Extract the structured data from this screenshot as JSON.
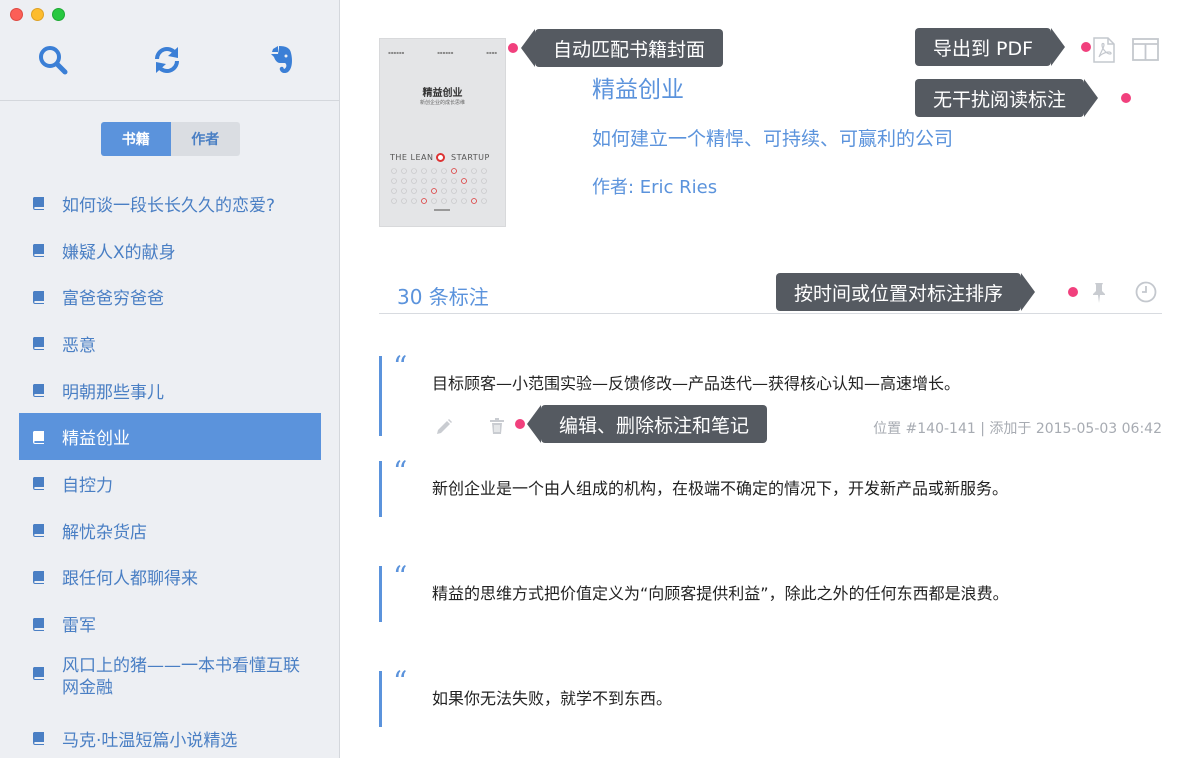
{
  "sidebar": {
    "tabs": [
      {
        "label": "书籍",
        "active": true
      },
      {
        "label": "作者",
        "active": false
      }
    ],
    "books": [
      {
        "title": "如何谈一段长长久久的恋爱?",
        "active": false
      },
      {
        "title": "嫌疑人X的献身",
        "active": false
      },
      {
        "title": "富爸爸穷爸爸",
        "active": false
      },
      {
        "title": "恶意",
        "active": false
      },
      {
        "title": "明朝那些事儿",
        "active": false
      },
      {
        "title": "精益创业",
        "active": true
      },
      {
        "title": "自控力",
        "active": false
      },
      {
        "title": "解忧杂货店",
        "active": false
      },
      {
        "title": "跟任何人都聊得来",
        "active": false
      },
      {
        "title": "雷军",
        "active": false
      },
      {
        "title": "风口上的猪——一本书看懂互联网金融",
        "active": false
      },
      {
        "title": "马克·吐温短篇小说精选",
        "active": false
      }
    ]
  },
  "book": {
    "title": "精益创业",
    "subtitle": "如何建立一个精悍、可持续、可赢利的公司",
    "author": "作者: Eric Ries",
    "cover": {
      "title": "精益创业",
      "subtitle": "新创企业的成长思维",
      "lean": "THE LEAN",
      "startup": "STARTUP"
    }
  },
  "annotations_header": {
    "count": "30 条标注"
  },
  "annotations": [
    {
      "text": "目标顾客—小范围实验—反馈修改—产品迭代—获得核心认知—高速增长。",
      "meta": "位置 #140-141 | 添加于 2015-05-03 06:42"
    },
    {
      "text": "新创企业是一个由人组成的机构，在极端不确定的情况下，开发新产品或新服务。",
      "meta": ""
    },
    {
      "text": "精益的思维方式把价值定义为“向顾客提供利益”，除此之外的任何东西都是浪费。",
      "meta": ""
    },
    {
      "text": "如果你无法失败，就学不到东西。",
      "meta": ""
    }
  ],
  "callouts": {
    "cover": "自动匹配书籍封面",
    "export": "导出到 PDF",
    "reading": "无干扰阅读标注",
    "sort": "按时间或位置对标注排序",
    "edit": "编辑、删除标注和笔记"
  },
  "colors": {
    "accent": "#5b93dc",
    "dot": "#f1407d",
    "callout_bg": "#555a61",
    "sidebar_bg": "#edeff3"
  }
}
